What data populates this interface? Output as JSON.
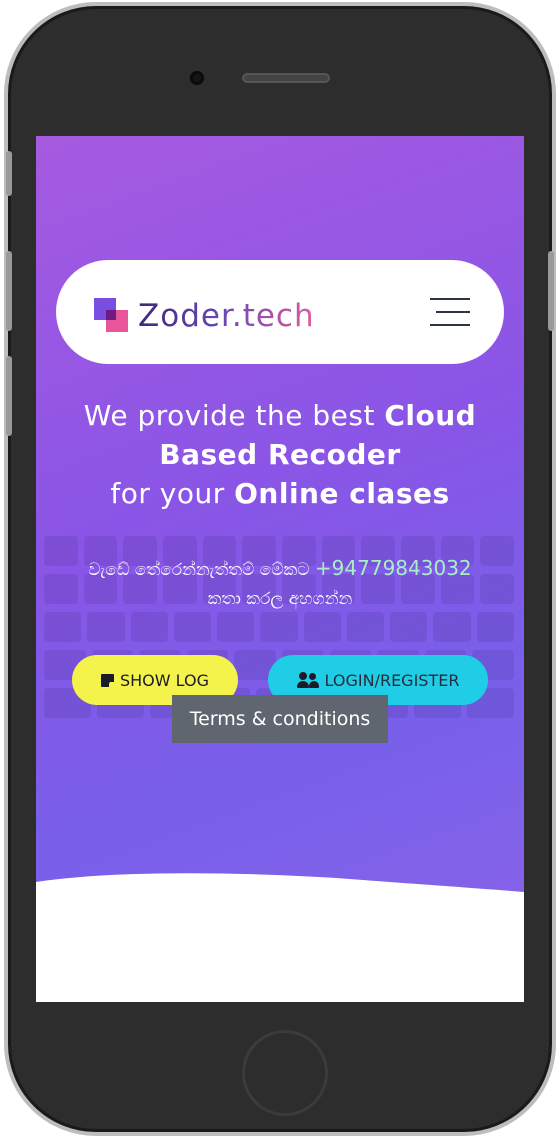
{
  "navbar": {
    "logo_text": "Zoder.tech",
    "menu_icon": "hamburger-menu-icon"
  },
  "hero": {
    "line1_light": "We provide the best ",
    "line1_bold": "Cloud",
    "line2_bold": "Based Recoder",
    "line3_light": "for your ",
    "line3_bold": "Online clases"
  },
  "contact": {
    "text_before": "වැඩේ තේරෙන්නැත්තම් මේකට ",
    "phone": "+94779843032",
    "text_after": "කතා කරල අහගන්න"
  },
  "buttons": {
    "show_log_label": "SHOW LOG",
    "show_log_icon": "note-icon",
    "login_label": "LOGIN/REGISTER",
    "login_icon": "users-icon"
  },
  "tooltip": {
    "label": "Terms & conditions"
  },
  "colors": {
    "gradient_start": "#a65ae0",
    "gradient_end": "#7860ea",
    "show_log_bg": "#f4f34b",
    "login_bg": "#1fcde6",
    "phone_link": "#a7f0c6",
    "tooltip_bg": "#5f6670"
  }
}
